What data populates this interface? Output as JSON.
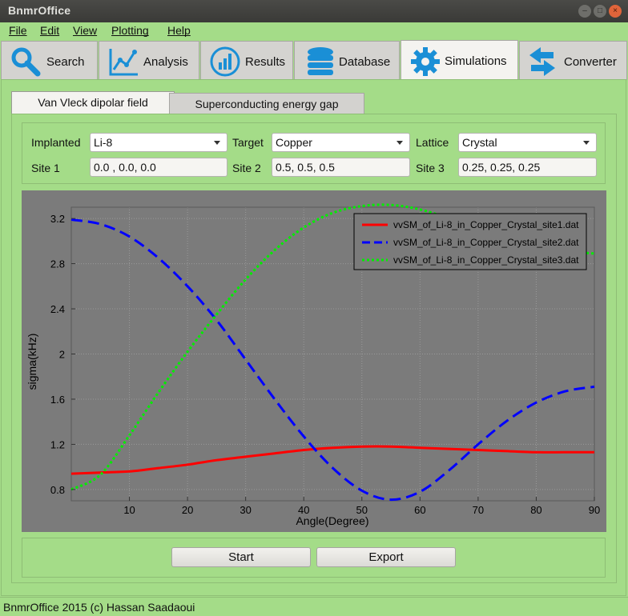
{
  "window": {
    "title": "BnmrOffice"
  },
  "menu": [
    "File",
    "Edit",
    "View",
    "Plotting",
    "Help"
  ],
  "main_tabs": [
    {
      "label": "Search",
      "icon": "search-icon"
    },
    {
      "label": "Analysis",
      "icon": "chart-line-icon"
    },
    {
      "label": "Results",
      "icon": "bar-chart-icon"
    },
    {
      "label": "Database",
      "icon": "database-icon"
    },
    {
      "label": "Simulations",
      "icon": "gear-icon",
      "active": true
    },
    {
      "label": "Converter",
      "icon": "convert-arrows-icon"
    }
  ],
  "sub_tabs": [
    {
      "label": "Van Vleck dipolar field",
      "active": true
    },
    {
      "label": "Superconducting energy gap"
    }
  ],
  "form": {
    "implanted_label": "Implanted",
    "implanted_value": "Li-8",
    "target_label": "Target",
    "target_value": "Copper",
    "lattice_label": "Lattice",
    "lattice_value": "Crystal",
    "site1_label": "Site 1",
    "site1_value": "0.0 , 0.0, 0.0",
    "site2_label": "Site 2",
    "site2_value": "0.5, 0.5, 0.5",
    "site3_label": "Site 3",
    "site3_value": "0.25, 0.25, 0.25"
  },
  "buttons": {
    "start": "Start",
    "export": "Export"
  },
  "status": "BnmrOffice 2015 (c) Hassan Saadaoui",
  "chart_data": {
    "type": "line",
    "xlabel": "Angle(Degree)",
    "ylabel": "sigma(kHz)",
    "xlim": [
      0,
      90
    ],
    "ylim": [
      0.7,
      3.3
    ],
    "xticks": [
      10,
      20,
      30,
      40,
      50,
      60,
      70,
      80,
      90
    ],
    "yticks": [
      0.8,
      1.2,
      1.6,
      2,
      2.4,
      2.8,
      3.2
    ],
    "grid": true,
    "legend_position": "top-right",
    "x": [
      0,
      5,
      10,
      15,
      20,
      25,
      30,
      35,
      40,
      45,
      50,
      55,
      60,
      65,
      70,
      75,
      80,
      85,
      90
    ],
    "series": [
      {
        "name": "vvSM_of_Li-8_in_Copper_Crystal_site1.dat",
        "color": "#ff0000",
        "style": "solid",
        "values": [
          0.94,
          0.95,
          0.96,
          0.99,
          1.02,
          1.06,
          1.09,
          1.12,
          1.15,
          1.17,
          1.18,
          1.18,
          1.17,
          1.16,
          1.15,
          1.14,
          1.13,
          1.13,
          1.13
        ]
      },
      {
        "name": "vvSM_of_Li-8_in_Copper_Crystal_site2.dat",
        "color": "#0000ff",
        "style": "dashed",
        "values": [
          3.19,
          3.15,
          3.04,
          2.85,
          2.6,
          2.3,
          1.95,
          1.6,
          1.27,
          0.99,
          0.79,
          0.71,
          0.78,
          0.97,
          1.2,
          1.41,
          1.57,
          1.67,
          1.71
        ]
      },
      {
        "name": "vvSM_of_Li-8_in_Copper_Crystal_site3.dat",
        "color": "#00ee00",
        "style": "dotted",
        "values": [
          0.8,
          0.93,
          1.28,
          1.66,
          2.02,
          2.35,
          2.66,
          2.92,
          3.12,
          3.25,
          3.31,
          3.32,
          3.28,
          3.2,
          3.1,
          3.01,
          2.95,
          2.91,
          2.89
        ]
      }
    ]
  }
}
